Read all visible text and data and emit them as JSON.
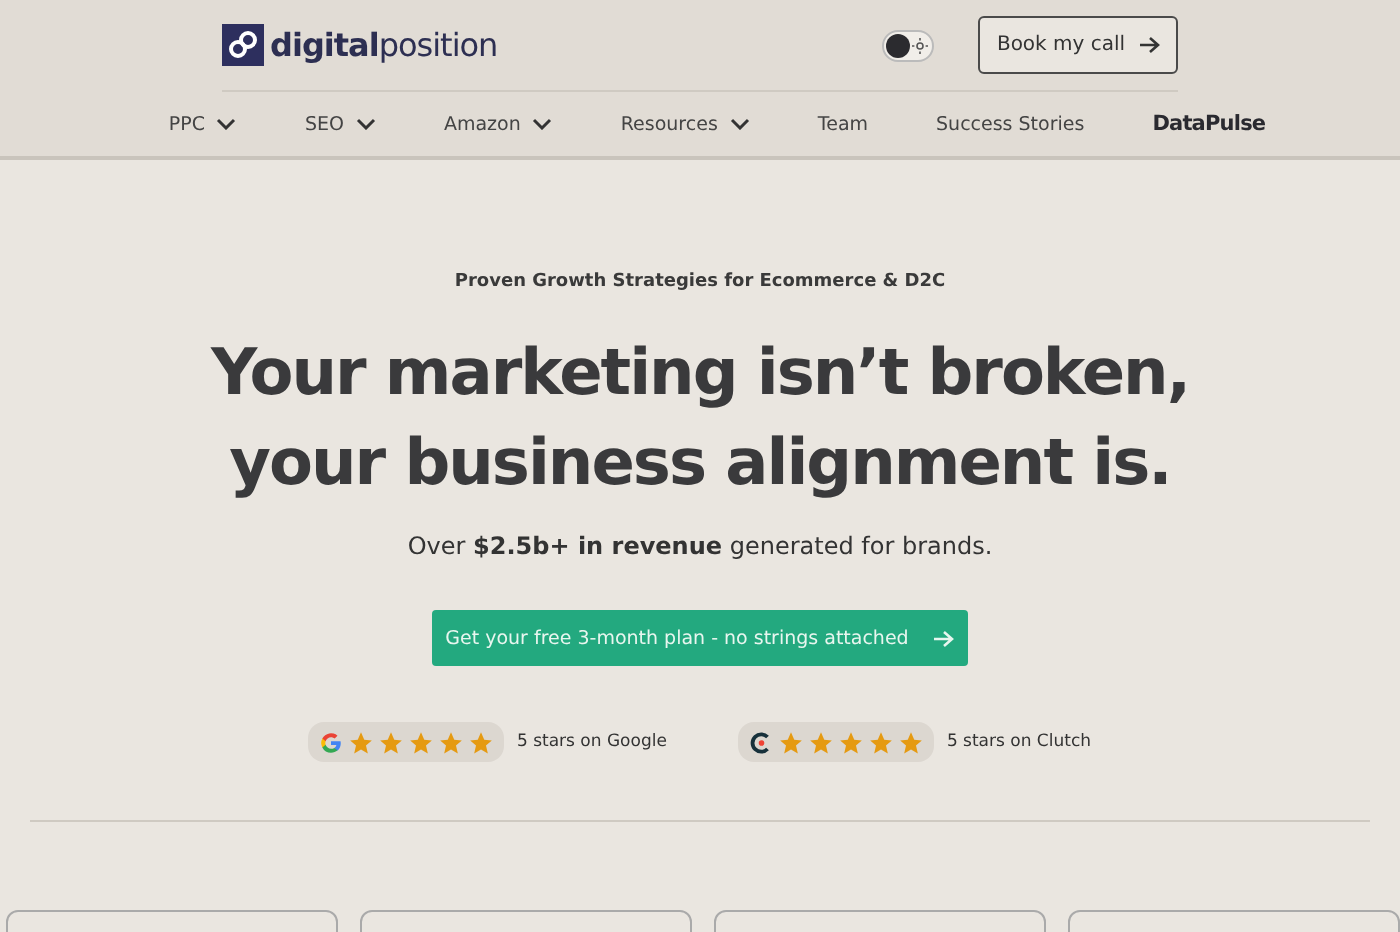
{
  "header": {
    "logo": {
      "bold": "digital",
      "light": "position"
    },
    "theme_toggle": {
      "on": false
    },
    "cta": "Book my call"
  },
  "nav": [
    {
      "label": "PPC",
      "dropdown": true
    },
    {
      "label": "SEO",
      "dropdown": true
    },
    {
      "label": "Amazon",
      "dropdown": true
    },
    {
      "label": "Resources",
      "dropdown": true
    },
    {
      "label": "Team",
      "dropdown": false
    },
    {
      "label": "Success Stories",
      "dropdown": false
    },
    {
      "label": "DataPulse",
      "kind": "brand"
    }
  ],
  "hero": {
    "eyebrow": "Proven Growth Strategies for Ecommerce & D2C",
    "headline": [
      "Your marketing isn’t broken,",
      "your business alignment is."
    ],
    "subline": "Over **$2.5b+ in revenue** generated for brands.",
    "cta": "Get your free 3-month plan - no strings attached"
  },
  "ratings": [
    {
      "kind": "google",
      "stars": 5,
      "label": "5 stars on Google"
    },
    {
      "kind": "clutch",
      "stars": 5,
      "label": "5 stars on Clutch"
    }
  ]
}
